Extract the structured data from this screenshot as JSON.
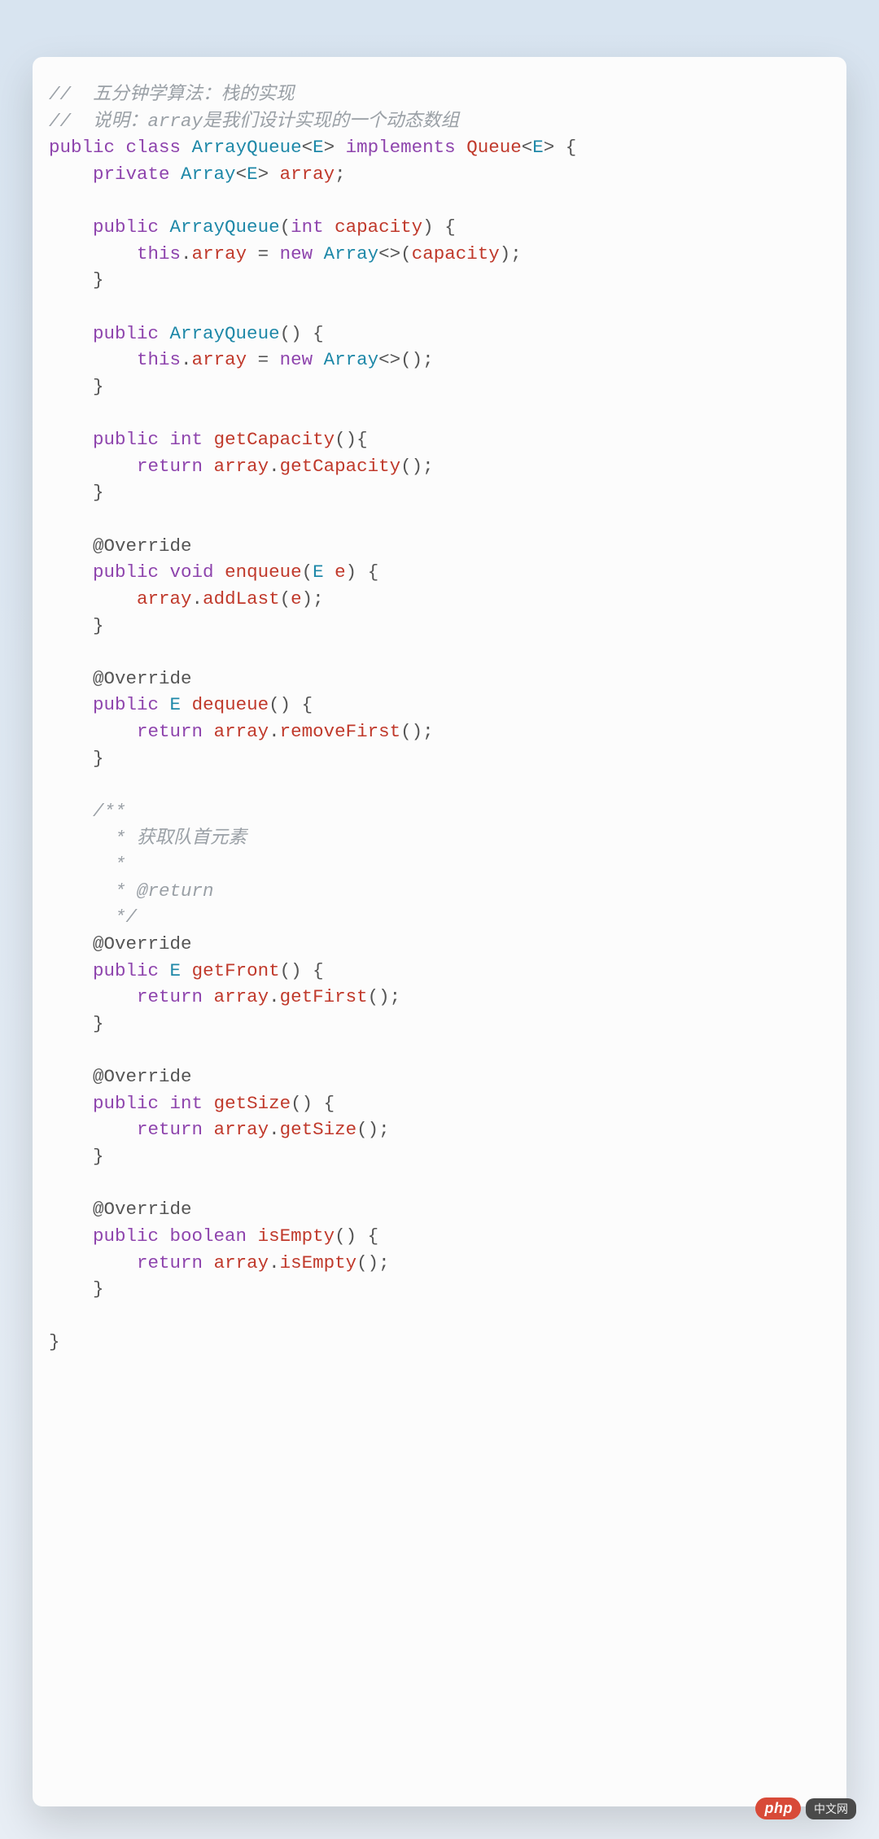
{
  "code": {
    "comment1": "//  五分钟学算法：栈的实现",
    "comment2": "//  说明：array是我们设计实现的一个动态数组",
    "kw_public": "public",
    "kw_class": "class",
    "kw_implements": "implements",
    "kw_private": "private",
    "kw_int": "int",
    "kw_void": "void",
    "kw_boolean": "boolean",
    "kw_return": "return",
    "kw_this": "this",
    "kw_new": "new",
    "cls_ArrayQueue": "ArrayQueue",
    "cls_Queue": "Queue",
    "cls_Array": "Array",
    "cls_E": "E",
    "var_array": "array",
    "param_capacity": "capacity",
    "param_e": "e",
    "m_getCapacity": "getCapacity",
    "m_enqueue": "enqueue",
    "m_dequeue": "dequeue",
    "m_getFront": "getFront",
    "m_getSize": "getSize",
    "m_isEmpty": "isEmpty",
    "m_addLast": "addLast",
    "m_removeFirst": "removeFirst",
    "m_getFirst": "getFirst",
    "ann_Override": "@Override",
    "doc1": "/**",
    "doc2": " * 获取队首元素",
    "doc3": " *",
    "doc4": " * @return",
    "doc5": " */"
  },
  "watermark": {
    "bubble": "php",
    "text": "中文网"
  }
}
